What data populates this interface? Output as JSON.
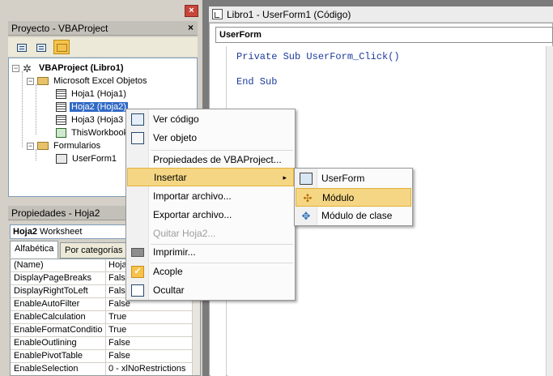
{
  "project_pane": {
    "title": "Proyecto - VBAProject",
    "close": "×",
    "tree": {
      "root": "VBAProject (Libro1)",
      "excel_folder": "Microsoft Excel Objetos",
      "sheets": [
        "Hoja1 (Hoja1)",
        "Hoja2 (Hoja2)",
        "Hoja3 (Hoja3",
        "ThisWorkbook"
      ],
      "forms_folder": "Formularios",
      "forms": [
        "UserForm1"
      ]
    }
  },
  "window_close": "×",
  "properties_pane": {
    "title": "Propiedades - Hoja2",
    "object_name": "Hoja2",
    "object_type": "Worksheet",
    "tabs": [
      "Alfabética",
      "Por categorías"
    ],
    "rows": [
      {
        "name": "(Name)",
        "value": "Hoja"
      },
      {
        "name": "DisplayPageBreaks",
        "value": "False"
      },
      {
        "name": "DisplayRightToLeft",
        "value": "False"
      },
      {
        "name": "EnableAutoFilter",
        "value": "False"
      },
      {
        "name": "EnableCalculation",
        "value": "True"
      },
      {
        "name": "EnableFormatCondition",
        "value": "True"
      },
      {
        "name": "EnableOutlining",
        "value": "False"
      },
      {
        "name": "EnablePivotTable",
        "value": "False"
      },
      {
        "name": "EnableSelection",
        "value": "0 - xlNoRestrictions"
      }
    ]
  },
  "code_window": {
    "title": "Libro1 - UserForm1 (Código)",
    "object_combo": "UserForm",
    "lines": [
      "Private Sub UserForm_Click()",
      "End Sub"
    ]
  },
  "context_menu": {
    "items": [
      {
        "label": "Ver código",
        "icon": "code-window-icon"
      },
      {
        "label": "Ver objeto",
        "icon": "object-view-icon"
      },
      {
        "label": "Propiedades de VBAProject..."
      },
      {
        "label": "Insertar",
        "submenu_arrow": "▸"
      },
      {
        "label": "Importar archivo..."
      },
      {
        "label": "Exportar archivo..."
      },
      {
        "label": "Quitar Hoja2..."
      },
      {
        "label": "Imprimir...",
        "icon": "printer-icon"
      },
      {
        "label": "Acople",
        "icon": "checkmark-icon"
      },
      {
        "label": "Ocultar",
        "icon": "hide-icon"
      }
    ]
  },
  "insert_submenu": {
    "items": [
      {
        "label": "UserForm",
        "icon": "userform-icon"
      },
      {
        "label": "Módulo",
        "icon": "module-icon"
      },
      {
        "label": "Módulo de clase",
        "icon": "class-module-icon"
      }
    ]
  },
  "colors": {
    "menu_highlight": "#f5d684",
    "selection": "#316ac5",
    "code_keyword": "#1d3a9b"
  }
}
